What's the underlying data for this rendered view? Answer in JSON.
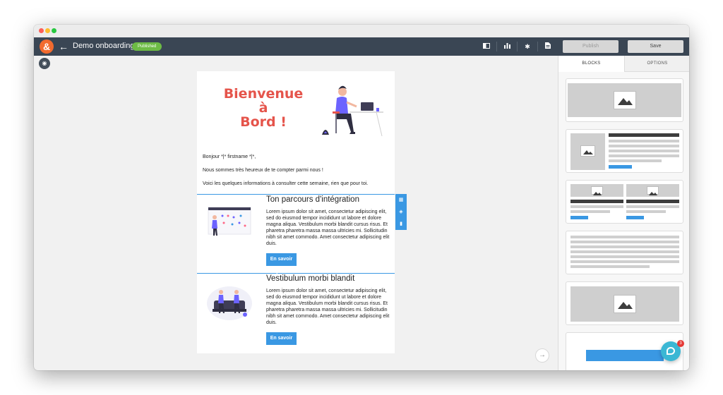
{
  "topbar": {
    "logo": "&",
    "title": "Demo onboarding",
    "status": "Published",
    "publish_label": "Publish",
    "save_label": "Save"
  },
  "email": {
    "hero_title_line1": "Bienvenue",
    "hero_title_line2": "à",
    "hero_title_line3": "Bord !",
    "greeting": "Bonjour *|* firstname *|*,",
    "intro": "Nous sommes très heureux de te compter parmi nous !",
    "info": "Voici les quelques informations à consulter cette semaine, rien que pour toi.",
    "blocks": [
      {
        "title": "Ton parcours d'intégration",
        "body": "Lorem ipsum dolor sit amet, consectetur adipiscing elit, sed do eiusmod tempor incididunt ut labore et dolore magna aliqua. Vestibulum morbi blandit cursus risus. Et pharetra pharetra massa massa ultricies mi. Sollicitudin nibh sit amet commodo. Amet consectetur adipiscing elit duis.",
        "cta": "En savoir plus"
      },
      {
        "title": "Vestibulum morbi blandit",
        "body": "Lorem ipsum dolor sit amet, consectetur adipiscing elit, sed do eiusmod tempor incididunt ut labore et dolore magna aliqua. Vestibulum morbi blandit cursus risus. Et pharetra pharetra massa massa ultricies mi. Sollicitudin nibh sit amet commodo. Amet consectetur adipiscing elit duis.",
        "cta": "En savoir plus"
      }
    ]
  },
  "panel": {
    "tabs": [
      "BLOCKS",
      "OPTIONS"
    ],
    "active_tab": "BLOCKS"
  },
  "chat": {
    "badge": "3"
  },
  "colors": {
    "accent": "#3a98e3",
    "topbar": "#3a4654",
    "status_green": "#6dbb45",
    "hero_red": "#e5544b",
    "logo_orange": "#f26b2f"
  }
}
